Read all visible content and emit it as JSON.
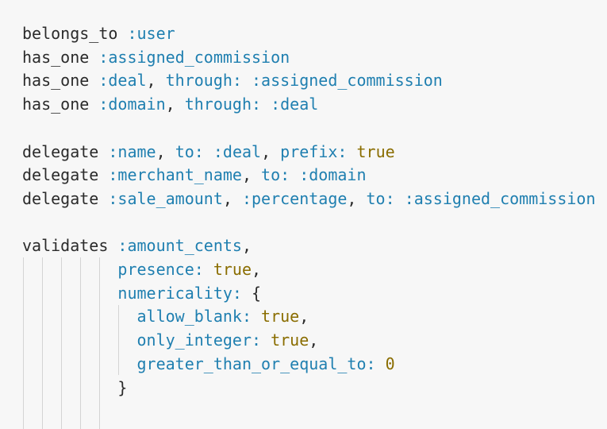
{
  "colors": {
    "background": "#f7f7f7",
    "plain": "#2b2b2b",
    "symbol": "#1f7fb0",
    "literal": "#8a6d00",
    "indent_guide": "#d4d4d4"
  },
  "code": {
    "lines": [
      [
        {
          "t": "belongs_to ",
          "k": "plain"
        },
        {
          "t": ":user",
          "k": "sym"
        }
      ],
      [
        {
          "t": "has_one ",
          "k": "plain"
        },
        {
          "t": ":assigned_commission",
          "k": "sym"
        }
      ],
      [
        {
          "t": "has_one ",
          "k": "plain"
        },
        {
          "t": ":deal",
          "k": "sym"
        },
        {
          "t": ", ",
          "k": "plain"
        },
        {
          "t": "through:",
          "k": "sym"
        },
        {
          "t": " ",
          "k": "plain"
        },
        {
          "t": ":assigned_commission",
          "k": "sym"
        }
      ],
      [
        {
          "t": "has_one ",
          "k": "plain"
        },
        {
          "t": ":domain",
          "k": "sym"
        },
        {
          "t": ", ",
          "k": "plain"
        },
        {
          "t": "through:",
          "k": "sym"
        },
        {
          "t": " ",
          "k": "plain"
        },
        {
          "t": ":deal",
          "k": "sym"
        }
      ],
      [],
      [
        {
          "t": "delegate ",
          "k": "plain"
        },
        {
          "t": ":name",
          "k": "sym"
        },
        {
          "t": ", ",
          "k": "plain"
        },
        {
          "t": "to:",
          "k": "sym"
        },
        {
          "t": " ",
          "k": "plain"
        },
        {
          "t": ":deal",
          "k": "sym"
        },
        {
          "t": ", ",
          "k": "plain"
        },
        {
          "t": "prefix:",
          "k": "sym"
        },
        {
          "t": " ",
          "k": "plain"
        },
        {
          "t": "true",
          "k": "bool"
        }
      ],
      [
        {
          "t": "delegate ",
          "k": "plain"
        },
        {
          "t": ":merchant_name",
          "k": "sym"
        },
        {
          "t": ", ",
          "k": "plain"
        },
        {
          "t": "to:",
          "k": "sym"
        },
        {
          "t": " ",
          "k": "plain"
        },
        {
          "t": ":domain",
          "k": "sym"
        }
      ],
      [
        {
          "t": "delegate ",
          "k": "plain"
        },
        {
          "t": ":sale_amount",
          "k": "sym"
        },
        {
          "t": ", ",
          "k": "plain"
        },
        {
          "t": ":percentage",
          "k": "sym"
        },
        {
          "t": ", ",
          "k": "plain"
        },
        {
          "t": "to:",
          "k": "sym"
        },
        {
          "t": " ",
          "k": "plain"
        },
        {
          "t": ":assigned_commission",
          "k": "sym"
        }
      ],
      [],
      [
        {
          "t": "validates ",
          "k": "plain"
        },
        {
          "t": ":amount_cents",
          "k": "sym"
        },
        {
          "t": ",",
          "k": "plain"
        }
      ],
      [
        {
          "t": "          ",
          "k": "plain"
        },
        {
          "t": "presence:",
          "k": "sym"
        },
        {
          "t": " ",
          "k": "plain"
        },
        {
          "t": "true",
          "k": "bool"
        },
        {
          "t": ",",
          "k": "plain"
        }
      ],
      [
        {
          "t": "          ",
          "k": "plain"
        },
        {
          "t": "numericality:",
          "k": "sym"
        },
        {
          "t": " {",
          "k": "plain"
        }
      ],
      [
        {
          "t": "            ",
          "k": "plain"
        },
        {
          "t": "allow_blank:",
          "k": "sym"
        },
        {
          "t": " ",
          "k": "plain"
        },
        {
          "t": "true",
          "k": "bool"
        },
        {
          "t": ",",
          "k": "plain"
        }
      ],
      [
        {
          "t": "            ",
          "k": "plain"
        },
        {
          "t": "only_integer:",
          "k": "sym"
        },
        {
          "t": " ",
          "k": "plain"
        },
        {
          "t": "true",
          "k": "bool"
        },
        {
          "t": ",",
          "k": "plain"
        }
      ],
      [
        {
          "t": "            ",
          "k": "plain"
        },
        {
          "t": "greater_than_or_equal_to:",
          "k": "sym"
        },
        {
          "t": " ",
          "k": "plain"
        },
        {
          "t": "0",
          "k": "num"
        }
      ],
      [
        {
          "t": "          ",
          "k": "plain"
        },
        {
          "t": "}",
          "k": "plain"
        }
      ],
      []
    ]
  }
}
